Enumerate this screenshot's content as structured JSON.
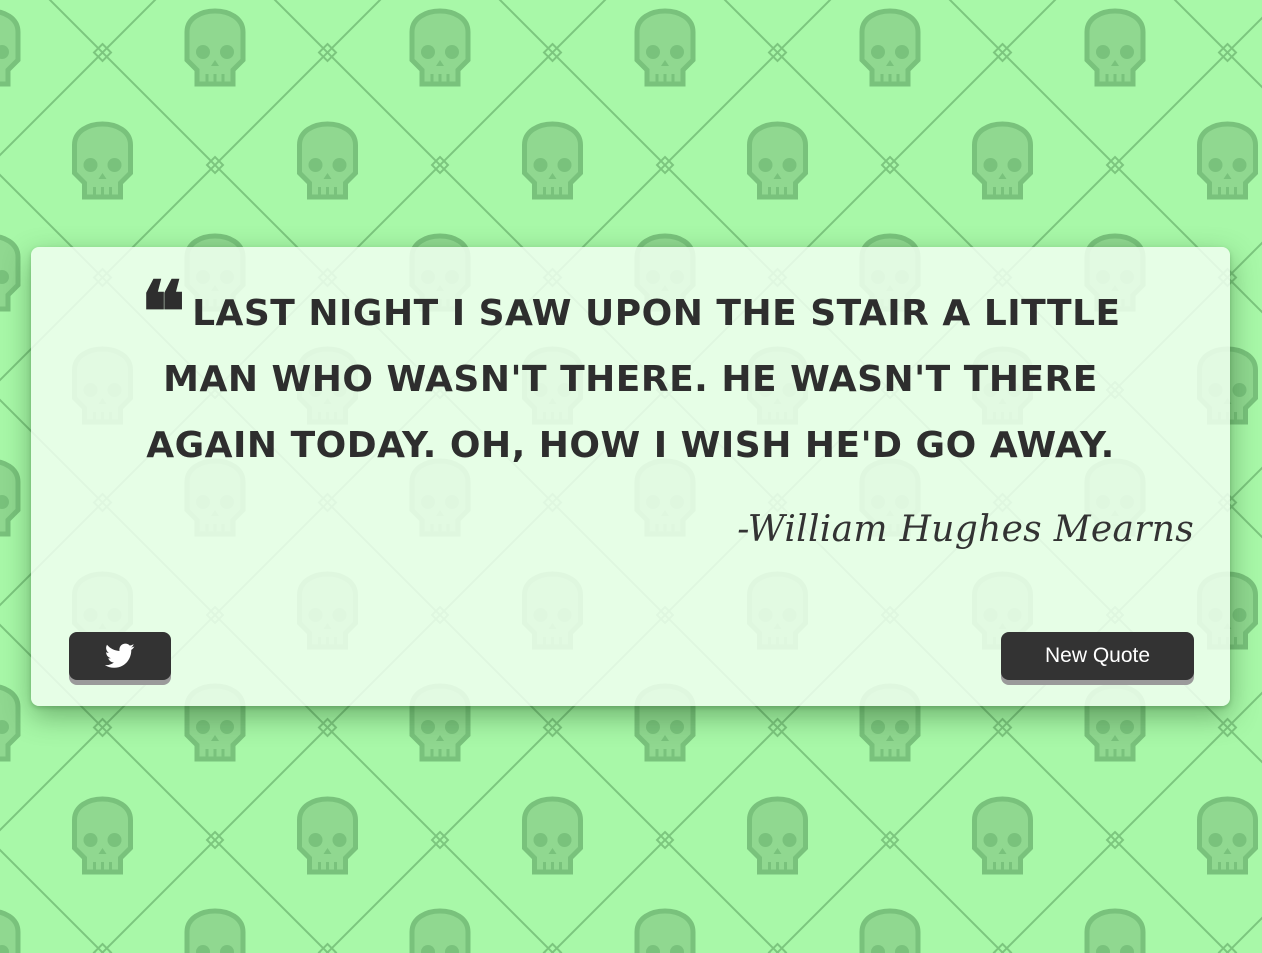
{
  "theme": {
    "background": "#a8f8a8",
    "pattern_color": "#76c27a",
    "card_background": "#f0fff0",
    "text_color": "#2e2e2e",
    "button_color": "#333333",
    "button_text_color": "#ffffff"
  },
  "background_pattern": {
    "icon": "skull-icon",
    "style": "diagonal-lattice"
  },
  "quote": {
    "mark": "❝",
    "text": "Last night I saw upon the stair a little man who wasn't there. He wasn't there again today. Oh, how I wish he'd go away.",
    "author": "-William Hughes Mearns"
  },
  "actions": {
    "tweet_icon": "twitter-bird-icon",
    "new_quote_label": "New Quote"
  }
}
